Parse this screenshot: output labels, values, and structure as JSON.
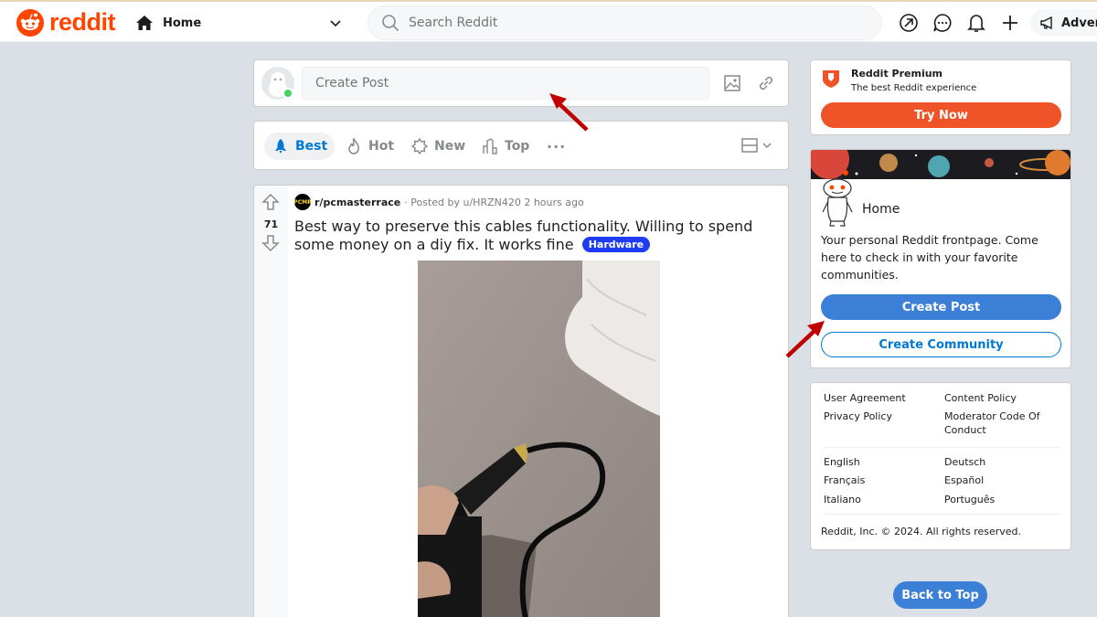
{
  "header": {
    "brand": "reddit",
    "feed": "Home",
    "search_placeholder": "Search Reddit",
    "advertise_label": "Advert"
  },
  "create_post_bar": {
    "placeholder": "Create Post"
  },
  "sort_bar": {
    "items": [
      {
        "label": "Best",
        "icon": "rocket-icon",
        "active": true
      },
      {
        "label": "Hot",
        "icon": "flame-icon"
      },
      {
        "label": "New",
        "icon": "burst-icon"
      },
      {
        "label": "Top",
        "icon": "top-chart-icon"
      }
    ]
  },
  "post": {
    "votes": "71",
    "subreddit": "r/pcmasterrace",
    "subreddit_icon_text": "PCMR",
    "posted_by": "· Posted by u/HRZN420 2 hours ago",
    "title": "Best way to preserve this cables functionality. Willing to spend some money on a diy fix. It works fine",
    "flair": "Hardware"
  },
  "premium": {
    "title": "Reddit Premium",
    "subtitle": "The best Reddit experience",
    "button": "Try Now"
  },
  "home_card": {
    "title": "Home",
    "description": "Your personal Reddit frontpage. Come here to check in with your favorite communities.",
    "create_post": "Create Post",
    "create_community": "Create Community"
  },
  "footer": {
    "links_left": [
      "User Agreement",
      "Privacy Policy"
    ],
    "links_right": [
      "Content Policy",
      "Moderator Code Of Conduct"
    ],
    "languages_left": [
      "English",
      "Français",
      "Italiano"
    ],
    "languages_right": [
      "Deutsch",
      "Español",
      "Português"
    ],
    "copyright": "Reddit, Inc. © 2024. All rights reserved."
  },
  "back_to_top": "Back to Top",
  "colors": {
    "brand": "#ff4500",
    "premium_button": "#ee5428",
    "primary_button": "#3b7fd6",
    "flair": "#1f3cf3",
    "annotation_arrow": "#c00000"
  }
}
